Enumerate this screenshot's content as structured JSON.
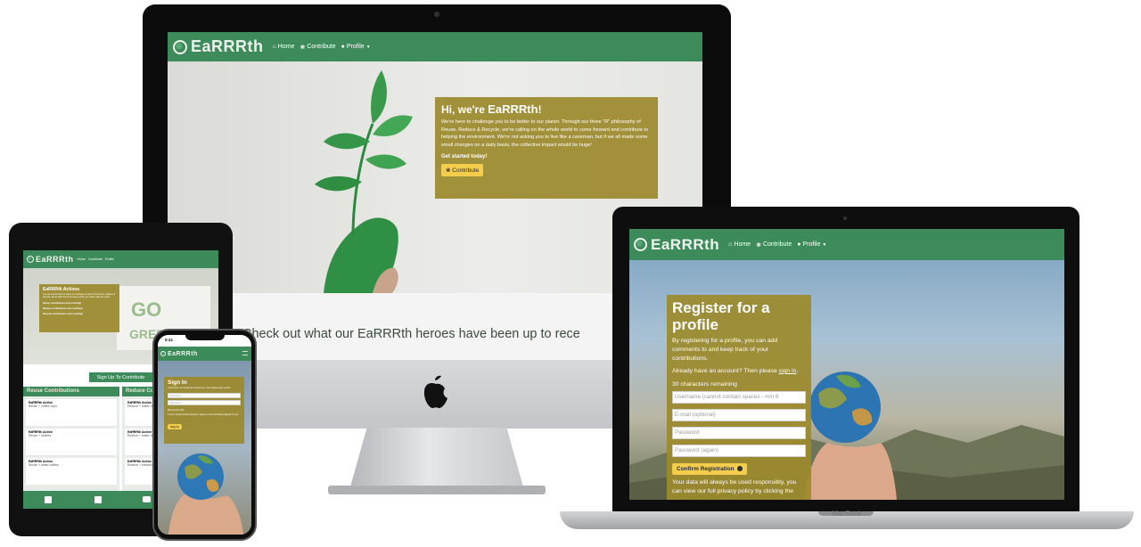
{
  "brand": "EaRRRth",
  "nav": {
    "home": "Home",
    "contribute": "Contribute",
    "profile": "Profile"
  },
  "imac": {
    "hero_title_prefix": "Hi, we're ",
    "hero_title_brand": "EaRRRth",
    "hero_title_suffix": "!",
    "hero_text": "We're here to challenge you to be better to our planet. Through our three \"R\" philosophy of Reuse, Reduce & Recycle, we're calling on the whole world to come forward and contribute to helping the environment. We're not asking you to live like a caveman, but if we all made some small changes on a daily basis, the collective impact would be huge!",
    "cta_text": "Get started today!",
    "cta_button": "Contribute",
    "below_heading": "Check out what our EaRRRth heroes have been up to rece"
  },
  "tablet": {
    "actions_title": "EaRRRth Actions",
    "actions_text": "You can use the form or below to contribute an action from Reuse, Reduce & Recycle. Be an earth friend and every action you make helps the world.",
    "actions_items": [
      "Reuse contributions and counting!",
      "Reduce contributions and counting!",
      "Recycle contributions and counting!"
    ],
    "hero_word_1": "GO",
    "hero_word_2": "GREE",
    "signup_button": "Sign Up To Contribute",
    "col_reuse": "Reuse Contributions",
    "col_reduce": "Reduce Contributions",
    "card_title": "EaRRRth Action",
    "reuse_cards": [
      "Reuse + coffee cups",
      "Reuse + clothes",
      "Reuse + water bottles"
    ],
    "reduce_cards": [
      "Reduce + water usage",
      "Reduce + water usage",
      "Reduce + electricity usage"
    ]
  },
  "phone": {
    "time": "9:41",
    "title": "Sign In",
    "subtitle": "If you have not created an account yet, then please sign up first.",
    "username_placeholder": "Username",
    "password_placeholder": "Password",
    "remember": "Remember Me",
    "note": "If you're having trouble signing in, please e-mail contributions@earrrth.com",
    "button": "Sign In"
  },
  "laptop": {
    "title": "Register for a profile",
    "text1": "By registering for a profile, you can add comments to and keep track of your contributions.",
    "text2_prefix": "Already have an account? Then please ",
    "text2_link": "sign in",
    "text2_suffix": ".",
    "chars_remaining": "30 characters remaining",
    "username_placeholder": "Username (cannot contain spaces - min 6",
    "email_placeholder": "E-mail (optional)",
    "password_placeholder": "Password",
    "password2_placeholder": "Password (again)",
    "button": "Confirm Registration",
    "footer_text": "Your data will always be used responsibly, you can view our full privacy policy by clicking the",
    "device_label": "MacBook"
  }
}
